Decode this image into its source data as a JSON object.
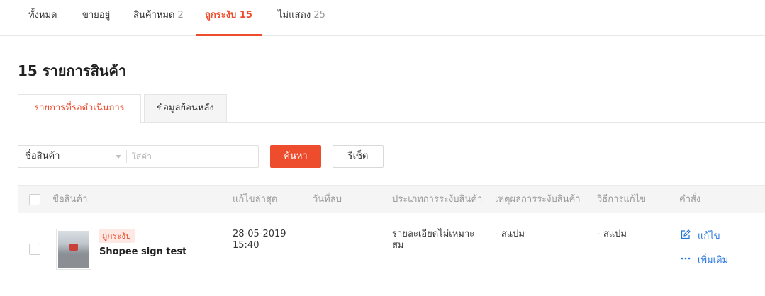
{
  "tabs": [
    {
      "label": "ทั้งหมด",
      "count": ""
    },
    {
      "label": "ขายอยู่",
      "count": ""
    },
    {
      "label": "สินค้าหมด",
      "count": "2"
    },
    {
      "label": "ถูกระงับ",
      "count": "15"
    },
    {
      "label": "ไม่แสดง",
      "count": "25"
    }
  ],
  "page_title": "15 รายการสินค้า",
  "subtabs": [
    "รายการที่รอดำเนินการ",
    "ข้อมูลย้อนหลัง"
  ],
  "filter": {
    "field_label": "ชื่อสินค้า",
    "placeholder": "ใส่ค่า",
    "search_label": "ค้นหา",
    "reset_label": "รีเซ็ต"
  },
  "table": {
    "columns": [
      "ชื่อสินค้า",
      "แก้ไขล่าสุด",
      "วันที่ลบ",
      "ประเภทการระงับสินค้า",
      "เหตุผลการระงับสินค้า",
      "วิธีการแก้ไข",
      "คำสั่ง"
    ],
    "rows": [
      {
        "badge": "ถูกระงับ",
        "name": "Shopee sign test",
        "last_edit_date": "28-05-2019",
        "last_edit_time": "15:40",
        "deleted": "—",
        "ban_type": "รายละเอียดไม่เหมาะสม",
        "reason": "- สแปม",
        "fix": "- สแปม",
        "actions": {
          "edit": "แก้ไข",
          "more": "เพิ่มเติม"
        }
      }
    ]
  },
  "colors": {
    "accent": "#ee4d2d",
    "link": "#2673dd"
  }
}
